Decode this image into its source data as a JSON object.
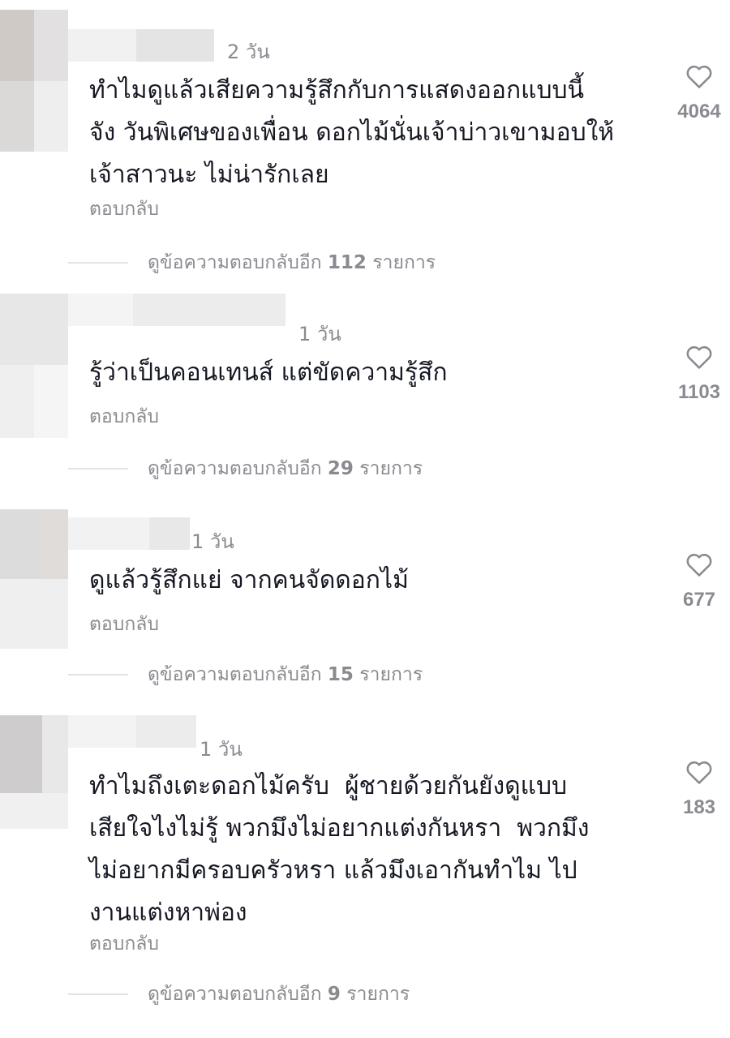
{
  "comments": [
    {
      "time": "2 วัน",
      "text": "ทำไมดูแล้วเสียความรู้สึกกับการแสดงออกแบบนี้\nจัง วันพิเศษของเพื่อน ดอกไม้นั่นเจ้าบ่าวเขามอบให้\nเจ้าสาวนะ ไม่น่ารักเลย",
      "reply_label": "ตอบกลับ",
      "likes": "4064",
      "view_replies_prefix": "ดูข้อความตอบกลับอีก",
      "view_replies_count": "112",
      "view_replies_suffix": "รายการ"
    },
    {
      "time": "1 วัน",
      "text": "รู้ว่าเป็นคอนเทนส์ แต่ขัดความรู้สึก",
      "reply_label": "ตอบกลับ",
      "likes": "1103",
      "view_replies_prefix": "ดูข้อความตอบกลับอีก",
      "view_replies_count": "29",
      "view_replies_suffix": "รายการ"
    },
    {
      "time": "1 วัน",
      "text": "ดูแล้วรู้สึกแย่ จากคนจัดดอกไม้",
      "reply_label": "ตอบกลับ",
      "likes": "677",
      "view_replies_prefix": "ดูข้อความตอบกลับอีก",
      "view_replies_count": "15",
      "view_replies_suffix": "รายการ"
    },
    {
      "time": "1 วัน",
      "text": "ทำไมถึงเตะดอกไม้ครับ  ผู้ชายด้วยกันยังดูแบบ\nเสียใจไงไม่รู้ พวกมึงไม่อยากแต่งกันหรา  พวกมึง\nไม่อยากมีครอบครัวหรา แล้วมึงเอากันทำไม ไป\nงานแต่งหาพ่อง",
      "reply_label": "ตอบกลับ",
      "likes": "183",
      "view_replies_prefix": "ดูข้อความตอบกลับอีก",
      "view_replies_count": "9",
      "view_replies_suffix": "รายการ"
    }
  ],
  "icons": {
    "like": "heart-outline-icon"
  },
  "colors": {
    "text": "#161823",
    "muted": "#8a8b91",
    "divider": "#e3e3e4"
  }
}
